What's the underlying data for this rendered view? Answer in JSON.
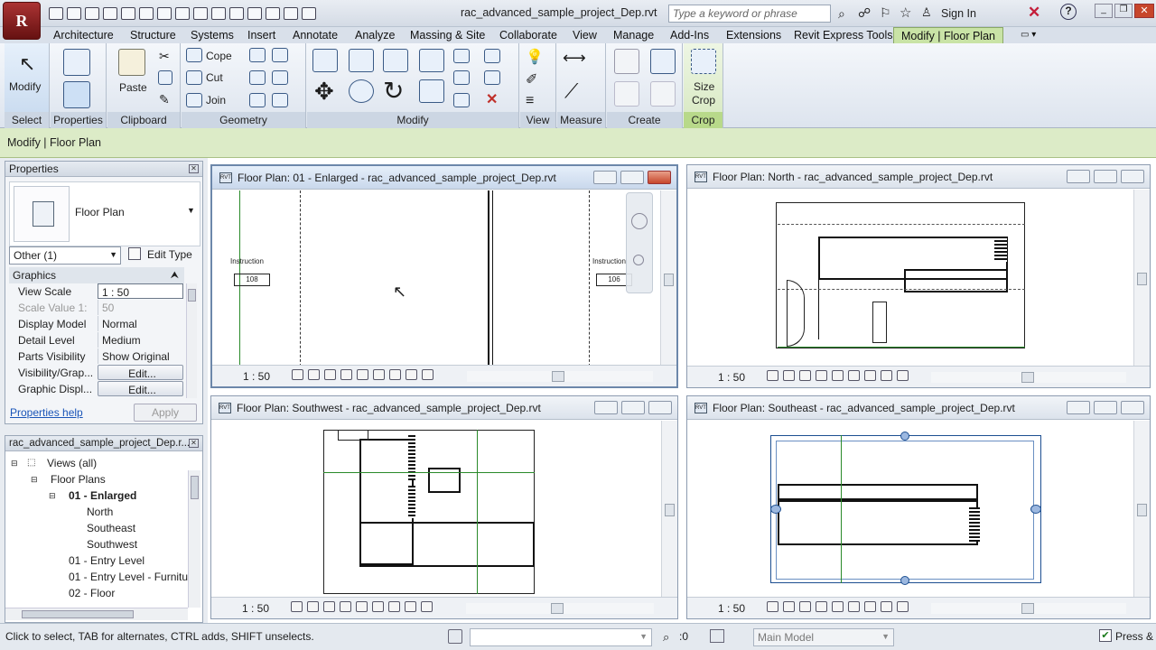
{
  "app": {
    "icon_letter": "R",
    "title": "rac_advanced_sample_project_Dep.rvt",
    "search_placeholder": "Type a keyword or phrase",
    "sign_in": "Sign In"
  },
  "tabs": [
    "Architecture",
    "Structure",
    "Systems",
    "Insert",
    "Annotate",
    "Analyze",
    "Massing & Site",
    "Collaborate",
    "View",
    "Manage",
    "Add-Ins",
    "Extensions",
    "Revit Express Tools",
    "Modify | Floor Plan"
  ],
  "ribbon": {
    "select": {
      "modify": "Modify",
      "panel": "Select"
    },
    "properties": {
      "panel": "Properties"
    },
    "clipboard": {
      "paste": "Paste",
      "panel": "Clipboard"
    },
    "geometry": {
      "cope": "Cope",
      "cut": "Cut",
      "join": "Join",
      "panel": "Geometry"
    },
    "modify": {
      "panel": "Modify"
    },
    "view": {
      "panel": "View"
    },
    "measure": {
      "panel": "Measure"
    },
    "create": {
      "panel": "Create"
    },
    "crop": {
      "size": "Size",
      "crop": "Crop",
      "panel": "Crop"
    }
  },
  "context_bar": "Modify | Floor Plan",
  "properties": {
    "title": "Properties",
    "type": "Floor Plan",
    "filter": "Other (1)",
    "edit_type": "Edit Type",
    "group": "Graphics",
    "rows": [
      {
        "k": "View Scale",
        "v": "1 : 50"
      },
      {
        "k": "Scale Value    1:",
        "v": "50"
      },
      {
        "k": "Display Model",
        "v": "Normal"
      },
      {
        "k": "Detail Level",
        "v": "Medium"
      },
      {
        "k": "Parts Visibility",
        "v": "Show Original"
      },
      {
        "k": "Visibility/Grap...",
        "v": "Edit..."
      },
      {
        "k": "Graphic Displ...",
        "v": "Edit..."
      }
    ],
    "help": "Properties help",
    "apply": "Apply"
  },
  "browser": {
    "title": "rac_advanced_sample_project_Dep.r...",
    "items": [
      "Views (all)",
      "Floor Plans",
      "01 - Enlarged",
      "North",
      "Southeast",
      "Southwest",
      "01 - Entry Level",
      "01 - Entry Level - Furnitu",
      "02 - Floor"
    ]
  },
  "views": [
    {
      "title": "Floor Plan: 01 - Enlarged - rac_advanced_sample_project_Dep.rvt",
      "scale": "1 : 50",
      "label1": "Instruction",
      "tag1": "108",
      "label2": "Instruction",
      "tag2": "106"
    },
    {
      "title": "Floor Plan: North - rac_advanced_sample_project_Dep.rvt",
      "scale": "1 : 50"
    },
    {
      "title": "Floor Plan: Southwest - rac_advanced_sample_project_Dep.rvt",
      "scale": "1 : 50"
    },
    {
      "title": "Floor Plan: Southeast - rac_advanced_sample_project_Dep.rvt",
      "scale": "1 : 50"
    }
  ],
  "status": {
    "hint": "Click to select, TAB for alternates, CTRL adds, SHIFT unselects.",
    "filter_count": ":0",
    "model": "Main Model",
    "press": "Press &"
  }
}
